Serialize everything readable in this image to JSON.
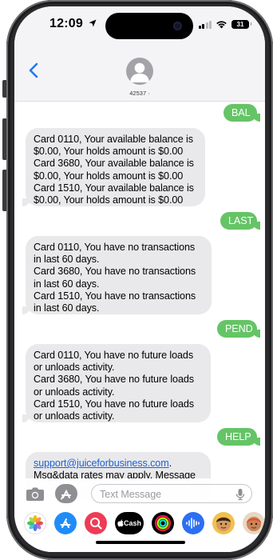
{
  "status_bar": {
    "time": "12:09",
    "battery": "31"
  },
  "header": {
    "contact_name": "42537",
    "contact_chevron": "›"
  },
  "messages": [
    {
      "direction": "outgoing",
      "text": "BAL"
    },
    {
      "direction": "incoming",
      "lines": [
        "Card 0110, Your available balance is",
        "$0.00, Your holds amount is $0.00",
        "Card 3680, Your available balance is",
        "$0.00, Your holds amount is $0.00",
        "Card 1510, Your available balance is",
        "$0.00, Your holds amount is $0.00"
      ]
    },
    {
      "direction": "outgoing",
      "text": "LAST"
    },
    {
      "direction": "incoming",
      "lines": [
        "Card 0110, You have no transactions",
        "in last 60 days.",
        " Card 3680, You have no transactions",
        "in last 60 days.",
        " Card 1510, You have no transactions",
        "in last 60 days."
      ]
    },
    {
      "direction": "outgoing",
      "text": "PEND"
    },
    {
      "direction": "incoming",
      "lines": [
        "Card 0110, You have no future loads",
        "or unloads activity.",
        " Card 3680, You have no future loads",
        "or unloads activity.",
        " Card 1510, You have no future loads",
        "or unloads activity."
      ]
    },
    {
      "direction": "outgoing",
      "text": "HELP"
    },
    {
      "direction": "incoming",
      "link": "support@juiceforbusiness.com",
      "link_suffix": ".",
      "lines": [
        "Msg&data rates may apply. Message"
      ]
    }
  ],
  "input": {
    "placeholder": "Text Message"
  },
  "app_tray": {
    "cash_label": "Cash",
    "items": [
      "photos-app",
      "app-store",
      "search-app",
      "apple-cash",
      "fitness-app",
      "audio-app",
      "memoji-1",
      "memoji-2"
    ]
  },
  "colors": {
    "imessage_green": "#65c466",
    "incoming_gray": "#e9e9eb",
    "link_blue": "#1a62d6",
    "accent_blue": "#1a7cf5"
  }
}
